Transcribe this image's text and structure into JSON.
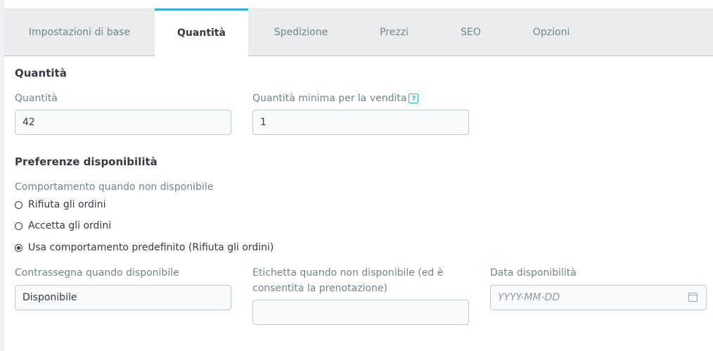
{
  "tabs": [
    {
      "label": "Impostazioni di base",
      "active": false
    },
    {
      "label": "Quantità",
      "active": true
    },
    {
      "label": "Spedizione",
      "active": false
    },
    {
      "label": "Prezzi",
      "active": false
    },
    {
      "label": "SEO",
      "active": false
    },
    {
      "label": "Opzioni",
      "active": false
    }
  ],
  "quantity_section": {
    "title": "Quantità",
    "quantity_label": "Quantità",
    "quantity_value": "42",
    "min_qty_label": "Quantità minima per la vendita",
    "help_icon": "?",
    "min_qty_value": "1"
  },
  "availability_section": {
    "title": "Preferenze disponibilità",
    "behavior_label": "Comportamento quando non disponibile",
    "options": [
      {
        "label": "Rifiuta gli ordini",
        "checked": false
      },
      {
        "label": "Accetta gli ordini",
        "checked": false
      },
      {
        "label": "Usa comportamento predefinito (Rifiuta gli ordini)",
        "checked": true
      }
    ],
    "in_stock_label": "Contrassegna quando disponibile",
    "in_stock_value": "Disponibile",
    "backorder_label_line1": "Etichetta quando non disponibile (ed è",
    "backorder_label_line2": "consentita la prenotazione)",
    "backorder_value": "",
    "date_label": "Data disponibilità",
    "date_placeholder": "YYYY-MM-DD",
    "date_icon": "calendar-icon"
  },
  "colors": {
    "accent": "#25b9d7",
    "text": "#363a41",
    "muted": "#6c868e",
    "border": "#bbcdd2"
  }
}
